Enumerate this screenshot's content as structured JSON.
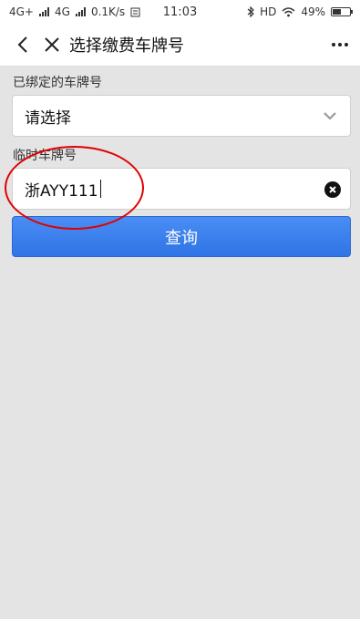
{
  "status_bar": {
    "network1": "4G+",
    "network2": "4G",
    "speed": "0.1K/s",
    "time": "11:03",
    "hd": "HD",
    "battery": "49%",
    "battery_level": 0.49
  },
  "navbar": {
    "title": "选择缴费车牌号"
  },
  "form": {
    "bound_label": "已绑定的车牌号",
    "bound_select_value": "请选择",
    "temp_label": "临时车牌号",
    "temp_input_value": "浙AYY111",
    "query_button": "查询"
  },
  "colors": {
    "primary": "#3a7ff0",
    "annotation": "#e00000",
    "background": "#e4e4e4"
  }
}
